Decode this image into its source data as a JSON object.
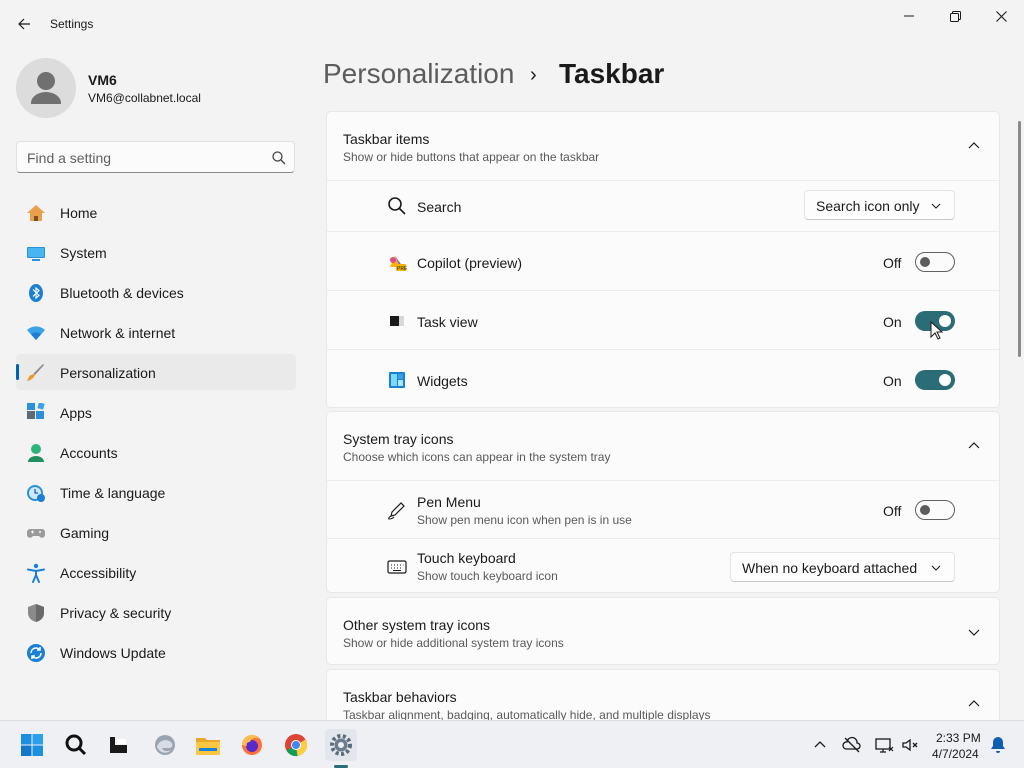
{
  "window": {
    "title": "Settings"
  },
  "user": {
    "name": "VM6",
    "email": "VM6@collabnet.local"
  },
  "search": {
    "placeholder": "Find a setting"
  },
  "sidebar": {
    "items": [
      {
        "label": "Home",
        "icon": "home-icon"
      },
      {
        "label": "System",
        "icon": "system-icon"
      },
      {
        "label": "Bluetooth & devices",
        "icon": "bluetooth-icon"
      },
      {
        "label": "Network & internet",
        "icon": "wifi-icon"
      },
      {
        "label": "Personalization",
        "icon": "brush-icon",
        "active": true
      },
      {
        "label": "Apps",
        "icon": "apps-icon"
      },
      {
        "label": "Accounts",
        "icon": "accounts-icon"
      },
      {
        "label": "Time & language",
        "icon": "time-language-icon"
      },
      {
        "label": "Gaming",
        "icon": "gamepad-icon"
      },
      {
        "label": "Accessibility",
        "icon": "accessibility-icon"
      },
      {
        "label": "Privacy & security",
        "icon": "shield-icon"
      },
      {
        "label": "Windows Update",
        "icon": "update-icon"
      }
    ]
  },
  "breadcrumb": {
    "parent": "Personalization",
    "separator": "›",
    "current": "Taskbar"
  },
  "sections": {
    "taskbar_items": {
      "title": "Taskbar items",
      "description": "Show or hide buttons that appear on the taskbar",
      "rows": {
        "search": {
          "label": "Search",
          "value": "Search icon only"
        },
        "copilot": {
          "label": "Copilot (preview)",
          "state": "Off"
        },
        "task_view": {
          "label": "Task view",
          "state": "On"
        },
        "widgets": {
          "label": "Widgets",
          "state": "On"
        }
      }
    },
    "system_tray": {
      "title": "System tray icons",
      "description": "Choose which icons can appear in the system tray",
      "rows": {
        "pen_menu": {
          "label": "Pen Menu",
          "sub": "Show pen menu icon when pen is in use",
          "state": "Off"
        },
        "touch_keyboard": {
          "label": "Touch keyboard",
          "sub": "Show touch keyboard icon",
          "value": "When no keyboard attached"
        }
      }
    },
    "other_tray": {
      "title": "Other system tray icons",
      "description": "Show or hide additional system tray icons"
    },
    "behaviors": {
      "title": "Taskbar behaviors",
      "description": "Taskbar alignment, badging, automatically hide, and multiple displays"
    }
  },
  "taskbar": {
    "apps": [
      "start-icon",
      "search-icon",
      "task-view-icon",
      "edge-icon",
      "file-explorer-icon",
      "firefox-icon",
      "chrome-icon",
      "settings-icon"
    ],
    "clock": {
      "time": "2:33 PM",
      "date": "4/7/2024"
    }
  },
  "colors": {
    "accent": "#2a6d77",
    "nav_accent": "#005fb8"
  }
}
